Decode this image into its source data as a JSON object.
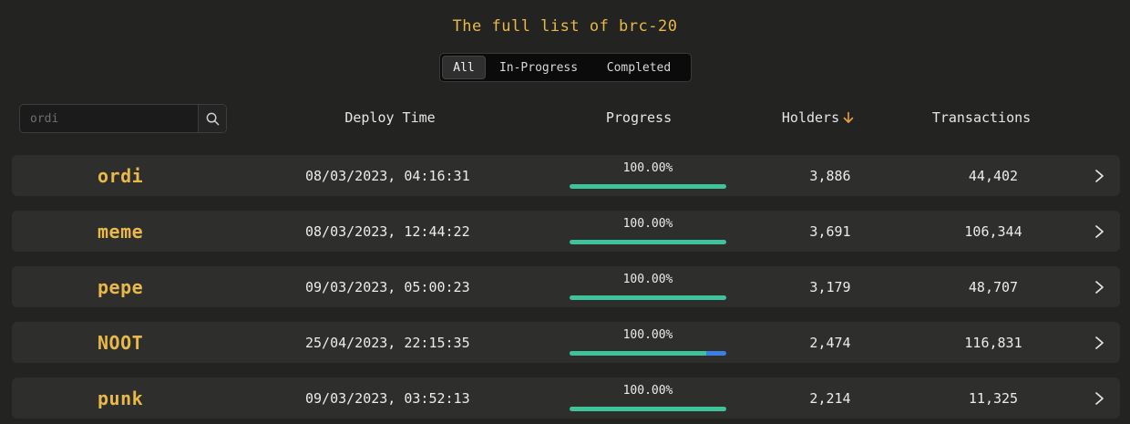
{
  "title": "The full list of brc-20",
  "tabs": [
    {
      "label": "All",
      "active": true
    },
    {
      "label": "In-Progress",
      "active": false
    },
    {
      "label": "Completed",
      "active": false
    }
  ],
  "search": {
    "placeholder": "ordi",
    "icon": "search-icon"
  },
  "columns": {
    "deploy_time": "Deploy Time",
    "progress": "Progress",
    "holders": "Holders",
    "transactions": "Transactions"
  },
  "sort": {
    "column": "holders",
    "direction": "desc",
    "icon": "arrow-down-icon",
    "color": "#e9a23b"
  },
  "colors": {
    "accent": "#e9b84a",
    "progress_fill": "#3fc39a",
    "progress_extra": "#3b7fe0"
  },
  "rows": [
    {
      "name": "ordi",
      "deploy_time": "08/03/2023, 04:16:31",
      "progress": "100.00%",
      "fill": 1.0,
      "holders": "3,886",
      "transactions": "44,402"
    },
    {
      "name": "meme",
      "deploy_time": "08/03/2023, 12:44:22",
      "progress": "100.00%",
      "fill": 1.0,
      "holders": "3,691",
      "transactions": "106,344"
    },
    {
      "name": "pepe",
      "deploy_time": "09/03/2023, 05:00:23",
      "progress": "100.00%",
      "fill": 1.0,
      "holders": "3,179",
      "transactions": "48,707"
    },
    {
      "name": "NOOT",
      "deploy_time": "25/04/2023, 22:15:35",
      "progress": "100.00%",
      "fill": 0.87,
      "holders": "2,474",
      "transactions": "116,831"
    },
    {
      "name": "punk",
      "deploy_time": "09/03/2023, 03:52:13",
      "progress": "100.00%",
      "fill": 1.0,
      "holders": "2,214",
      "transactions": "11,325"
    }
  ]
}
